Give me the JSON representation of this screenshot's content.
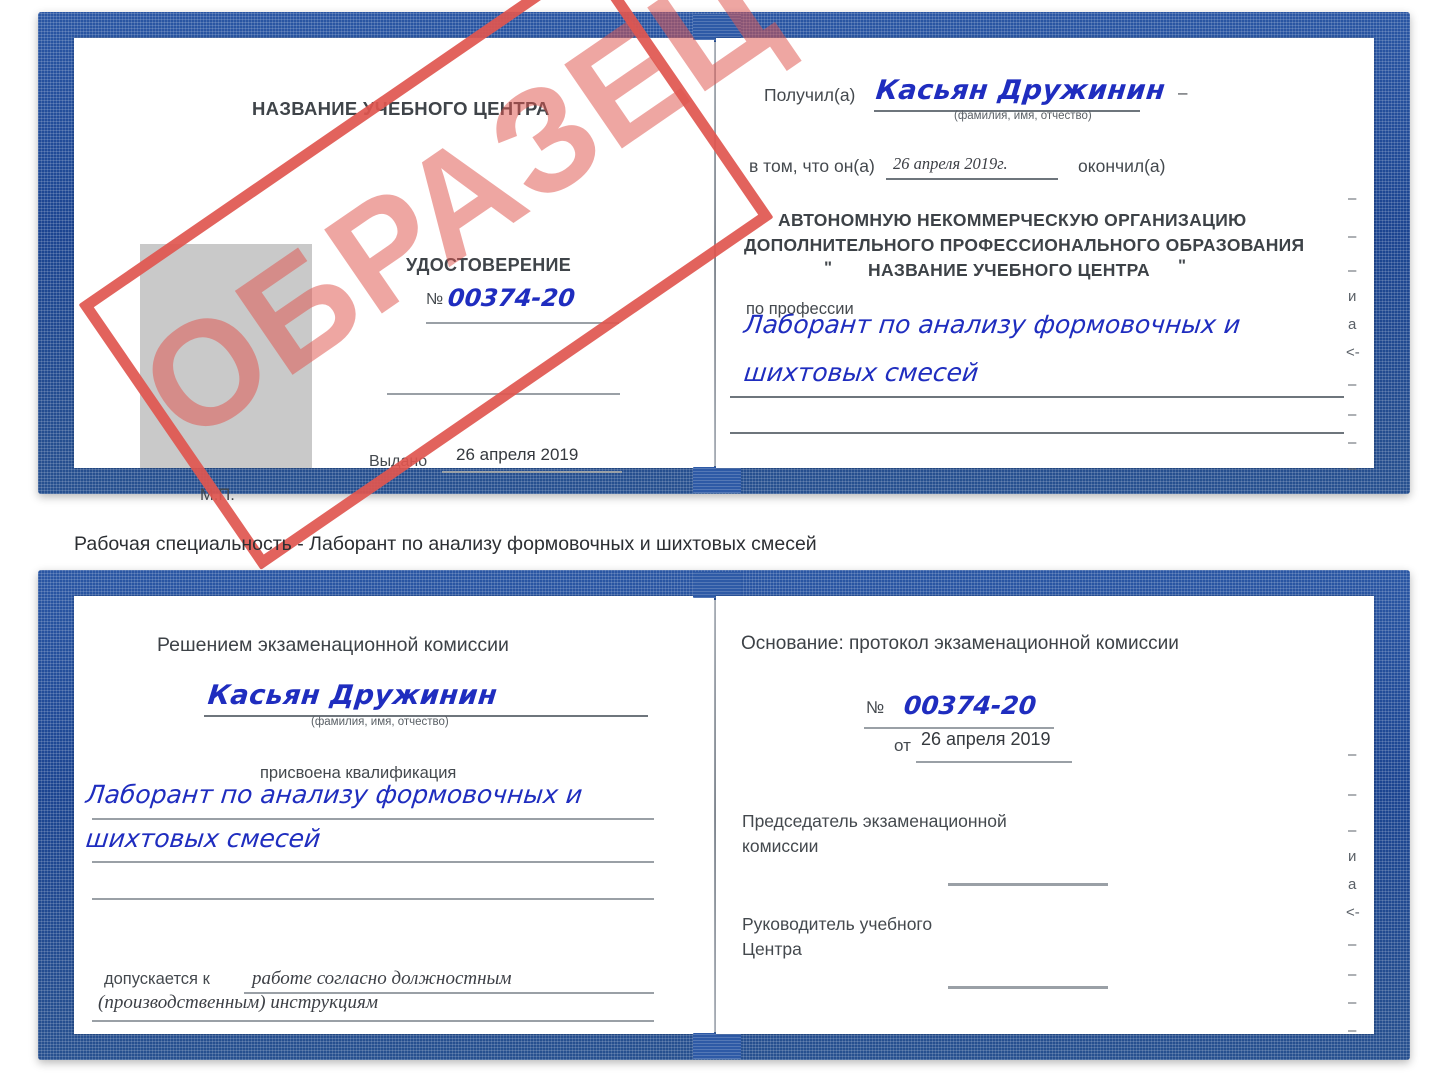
{
  "watermark": {
    "label": "ОБРАЗЕЦ",
    "color": "#e0564f"
  },
  "caption": "Рабочая специальность - Лаборант по анализу формовочных и шихтовых смесей",
  "colors": {
    "cover": "#1f4b96",
    "handwriting": "#1f2dbf",
    "print": "#44494e",
    "photo_placeholder": "#c9c9c9"
  },
  "booklet_top": {
    "left_page": {
      "center_name": "НАЗВАНИЕ УЧЕБНОГО ЦЕНТРА",
      "doc_type": "УДОСТОВЕРЕНИЕ",
      "number_label": "№",
      "number_value": "00374-20",
      "issued_label": "Выдано",
      "issued_value": "26 апреля 2019",
      "seal_label": "М.П."
    },
    "right_page": {
      "received_label": "Получил(а)",
      "received_value": "Касьян Дружинин",
      "fio_hint": "(фамилия, имя, отчество)",
      "in_that_label": "в том, что он(а)",
      "in_that_value": "26 апреля 2019г.",
      "finished_label": "окончил(а)",
      "org_line1": "АВТОНОМНУЮ НЕКОММЕРЧЕСКУЮ ОРГАНИЗАЦИЮ",
      "org_line2": "ДОПОЛНИТЕЛЬНОГО ПРОФЕССИОНАЛЬНОГО ОБРАЗОВАНИЯ",
      "org_quote_open": "\"",
      "org_name": "НАЗВАНИЕ УЧЕБНОГО ЦЕНТРА",
      "org_quote_close": "\"",
      "profession_label": "по профессии",
      "profession_line1": "Лаборант по анализу формовочных и",
      "profession_line2": "шихтовых смесей",
      "bleed_marks": [
        "–",
        "–",
        "–",
        "и",
        "а",
        "<-",
        "–",
        "–",
        "–",
        "–"
      ]
    }
  },
  "booklet_bottom": {
    "left_page": {
      "heading": "Решением экзаменационной комиссии",
      "name_value": "Касьян Дружинин",
      "fio_hint": "(фамилия, имя, отчество)",
      "qualification_label": "присвоена квалификация",
      "qualification_line1": "Лаборант по анализу формовочных и",
      "qualification_line2": "шихтовых смесей",
      "admitted_label": "допускается к",
      "admitted_line1": "работе согласно должностным",
      "admitted_line2": "(производственным) инструкциям"
    },
    "right_page": {
      "basis_label": "Основание: протокол экзаменационной комиссии",
      "number_label": "№",
      "number_value": "00374-20",
      "date_label": "от",
      "date_value": "26 апреля 2019",
      "chairman_line1": "Председатель экзаменационной",
      "chairman_line2": "комиссии",
      "head_line1": "Руководитель учебного",
      "head_line2": "Центра",
      "bleed_marks": [
        "–",
        "–",
        "–",
        "и",
        "а",
        "<-",
        "–",
        "–",
        "–",
        "–"
      ]
    }
  }
}
